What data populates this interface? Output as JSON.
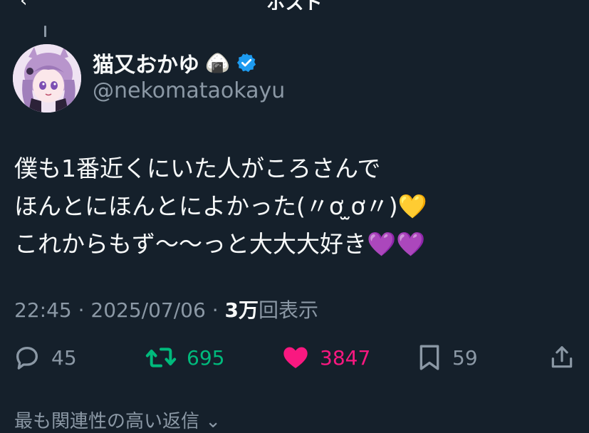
{
  "header": {
    "title": "ポスト",
    "back_icon": "back-arrow-icon"
  },
  "author": {
    "name": "猫又おかゆ",
    "name_emoji": "🍙",
    "verified_color": "#1d9bf0",
    "handle": "@nekomataokayu"
  },
  "post": {
    "lines": [
      "僕も1番近くにいた人がころさんで",
      "ほんとにほんとによかった(〃ơ ̫ơ〃)💛",
      "これからもず〜〜っと大大大好き💜💜"
    ]
  },
  "meta": {
    "time": "22:45",
    "sep1": " · ",
    "date": "2025/07/06",
    "sep2": " · ",
    "views": "3万",
    "views_label": "回表示"
  },
  "actions": {
    "replies": "45",
    "reposts": "695",
    "likes": "3847",
    "bookmarks": "59"
  },
  "colors": {
    "background": "#15202b",
    "repost_active": "#00ba7c",
    "like_active": "#f91880",
    "muted": "#8b98a5"
  },
  "sort": {
    "label": "最も関連性の高い返信",
    "chevron_icon": "chevron-down-icon"
  }
}
